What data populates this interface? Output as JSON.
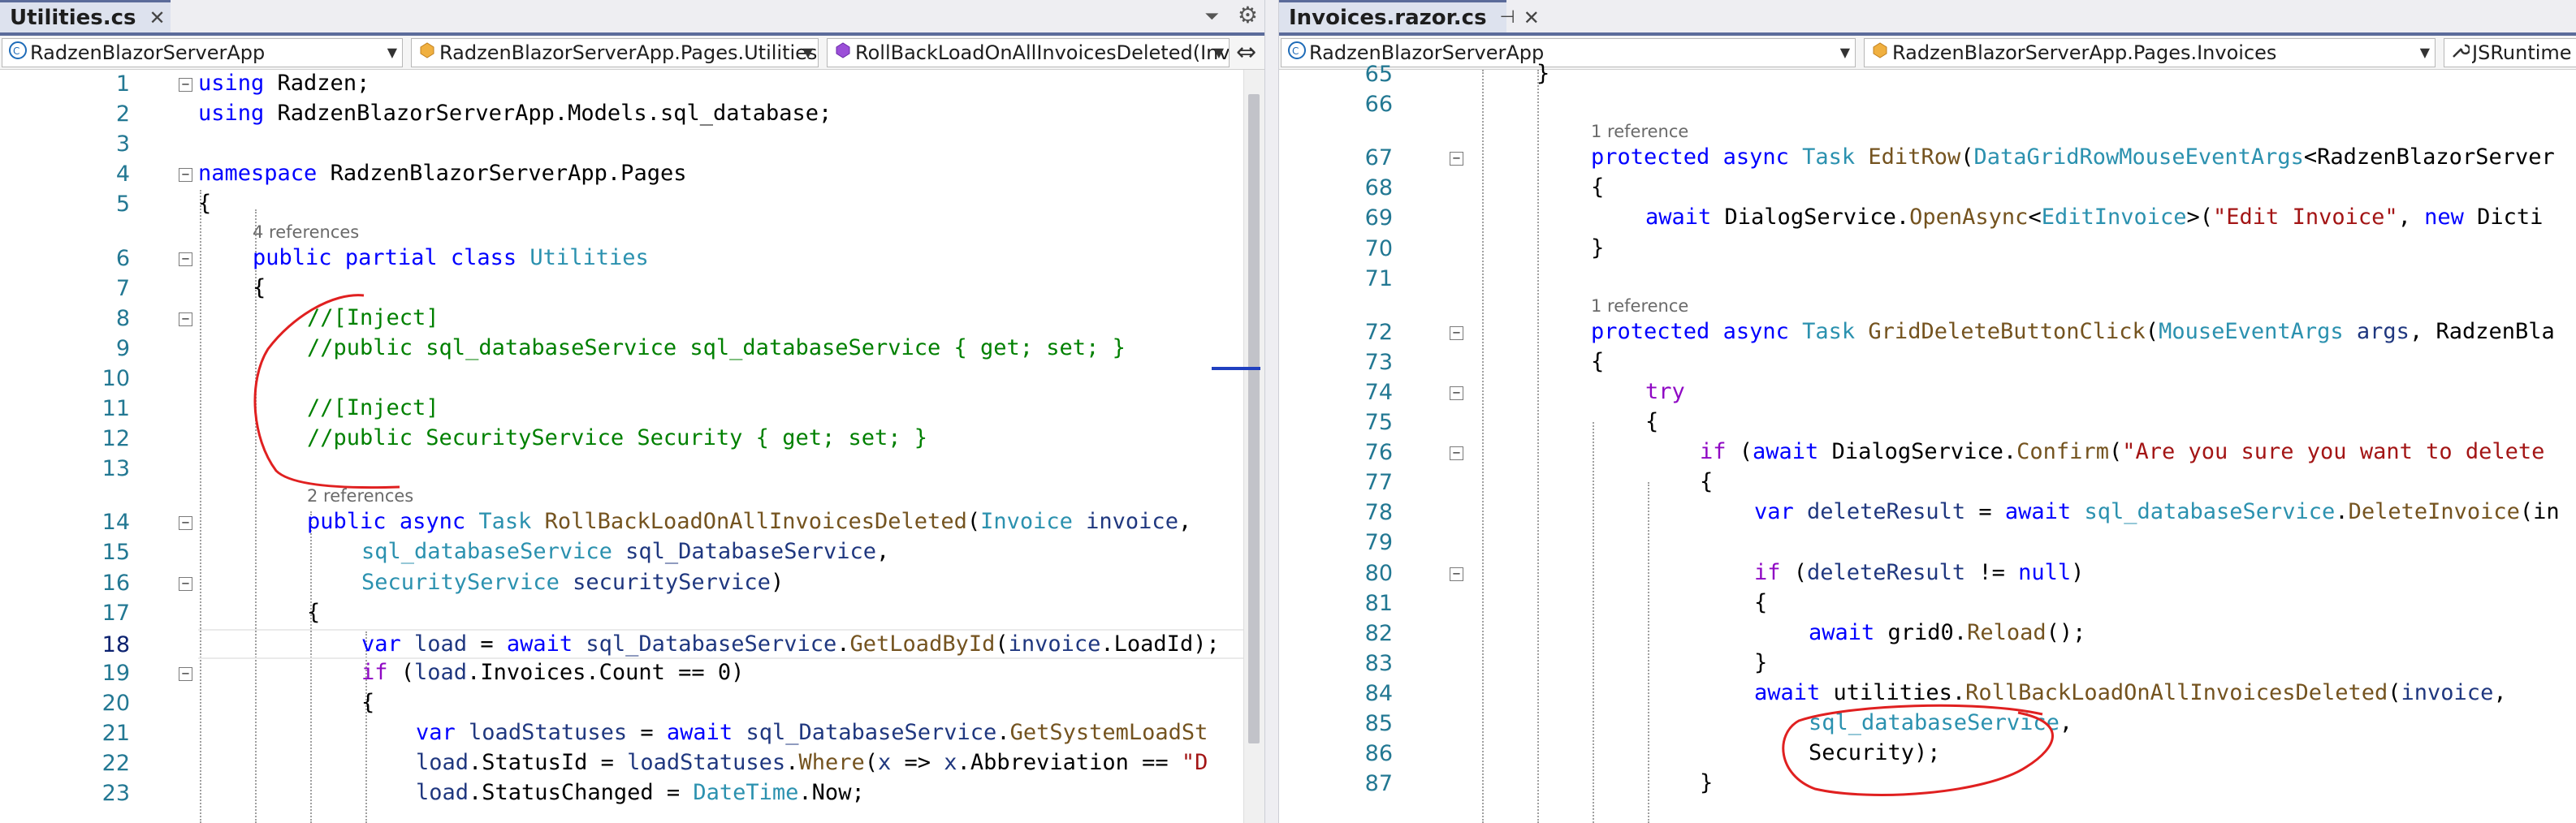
{
  "left": {
    "tab": {
      "title": "Utilities.cs",
      "close_glyph": "✕",
      "pin_glyph": "⊣"
    },
    "strip_icons": {
      "dropdown": "⏷",
      "settings": "⚙"
    },
    "nav": {
      "project": "RadzenBlazorServerApp",
      "type": "RadzenBlazorServerApp.Pages.Utilities",
      "member": "RollBackLoadOnAllInvoicesDeleted(Invoic"
    },
    "lines": [
      {
        "n": "1",
        "t": "using Radzen;"
      },
      {
        "n": "2",
        "t": "using RadzenBlazorServerApp.Models.sql_database;"
      },
      {
        "n": "3",
        "t": ""
      },
      {
        "n": "4",
        "t": "namespace RadzenBlazorServerApp.Pages"
      },
      {
        "n": "5",
        "t": "{"
      },
      {
        "n": "6",
        "t": "public partial class Utilities",
        "ref": "4 references"
      },
      {
        "n": "7",
        "t": "{"
      },
      {
        "n": "8",
        "t": "//[Inject]"
      },
      {
        "n": "9",
        "t": "//public sql_databaseService sql_databaseService { get; set; }"
      },
      {
        "n": "10",
        "t": ""
      },
      {
        "n": "11",
        "t": "//[Inject]"
      },
      {
        "n": "12",
        "t": "//public SecurityService Security { get; set; }"
      },
      {
        "n": "13",
        "t": ""
      },
      {
        "n": "14",
        "t": "public async Task RollBackLoadOnAllInvoicesDeleted(Invoice invoice,",
        "ref": "2 references"
      },
      {
        "n": "15",
        "t": "sql_databaseService sql_DatabaseService,"
      },
      {
        "n": "16",
        "t": "SecurityService securityService)"
      },
      {
        "n": "17",
        "t": "{"
      },
      {
        "n": "18",
        "t": "var load = await sql_DatabaseService.GetLoadById(invoice.LoadId);"
      },
      {
        "n": "19",
        "t": "if (load.Invoices.Count == 0)"
      },
      {
        "n": "20",
        "t": "{"
      },
      {
        "n": "21",
        "t": "var loadStatuses = await sql_DatabaseService.GetSystemLoadSt"
      },
      {
        "n": "22",
        "t": "load.StatusId = loadStatuses.Where(x => x.Abbreviation == \"D"
      },
      {
        "n": "23",
        "t": "load.StatusChanged = DateTime.Now;"
      }
    ]
  },
  "right": {
    "tab": {
      "title": "Invoices.razor.cs",
      "close_glyph": "✕",
      "pin_glyph": "⊣"
    },
    "nav": {
      "project": "RadzenBlazorServerApp",
      "type": "RadzenBlazorServerApp.Pages.Invoices",
      "member": "JSRuntime"
    },
    "lines": [
      {
        "n": "65",
        "t": "}"
      },
      {
        "n": "66",
        "t": ""
      },
      {
        "n": "67",
        "t": "protected async Task EditRow(DataGridRowMouseEventArgs<RadzenBlazorServer",
        "ref": "1 reference"
      },
      {
        "n": "68",
        "t": "{"
      },
      {
        "n": "69",
        "t": "await DialogService.OpenAsync<EditInvoice>(\"Edit Invoice\", new Dicti"
      },
      {
        "n": "70",
        "t": "}"
      },
      {
        "n": "71",
        "t": ""
      },
      {
        "n": "72",
        "t": "protected async Task GridDeleteButtonClick(MouseEventArgs args, RadzenBla",
        "ref": "1 reference"
      },
      {
        "n": "73",
        "t": "{"
      },
      {
        "n": "74",
        "t": "try"
      },
      {
        "n": "75",
        "t": "{"
      },
      {
        "n": "76",
        "t": "if (await DialogService.Confirm(\"Are you sure you want to delete"
      },
      {
        "n": "77",
        "t": "{"
      },
      {
        "n": "78",
        "t": "var deleteResult = await sql_databaseService.DeleteInvoice(in"
      },
      {
        "n": "79",
        "t": ""
      },
      {
        "n": "80",
        "t": "if (deleteResult != null)"
      },
      {
        "n": "81",
        "t": "{"
      },
      {
        "n": "82",
        "t": "await grid0.Reload();"
      },
      {
        "n": "83",
        "t": "}"
      },
      {
        "n": "84",
        "t": "await utilities.RollBackLoadOnAllInvoicesDeleted(invoice,"
      },
      {
        "n": "85",
        "t": "sql_databaseService,"
      },
      {
        "n": "86",
        "t": "Security);"
      },
      {
        "n": "87",
        "t": "}"
      }
    ]
  },
  "colors": {
    "keyword": "#0000ff",
    "control_keyword": "#8f08c4",
    "type": "#2b91af",
    "method": "#74531f",
    "string": "#a31515",
    "comment": "#008000",
    "parameter": "#1f377f",
    "line_number": "#237893",
    "annotation": "#e02020"
  },
  "icons": {
    "lightbulb": "lightbulb-icon",
    "csharp_project": "csharp-project-icon",
    "class": "class-icon",
    "method": "method-icon"
  }
}
